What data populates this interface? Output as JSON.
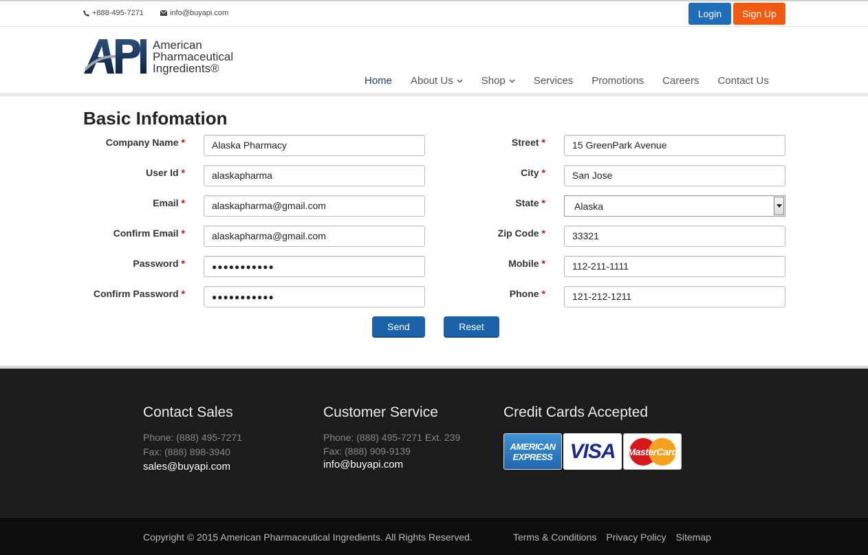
{
  "topbar": {
    "phone": "+888-495-7271",
    "email": "info@buyapi.com",
    "login_label": "Login",
    "signup_label": "Sign Up"
  },
  "logo": {
    "mark": "API",
    "line1": "American",
    "line2": "Pharmaceutical",
    "line3": "Ingredients®"
  },
  "nav": {
    "items": [
      "Home",
      "About Us",
      "Shop",
      "Services",
      "Promotions",
      "Careers",
      "Contact Us"
    ]
  },
  "form": {
    "title": "Basic Infomation",
    "required_mark": "*",
    "left": {
      "company_label": "Company Name",
      "company_value": "Alaska Pharmacy",
      "userid_label": "User Id",
      "userid_value": "alaskapharma",
      "email_label": "Email",
      "email_value": "alaskapharma@gmail.com",
      "confirm_email_label": "Confirm Email",
      "confirm_email_value": "alaskapharma@gmail.com",
      "password_label": "Password",
      "password_value": "●●●●●●●●●●●",
      "confirm_password_label": "Confirm Password",
      "confirm_password_value": "●●●●●●●●●●●"
    },
    "right": {
      "street_label": "Street",
      "street_value": "15 GreenPark Avenue",
      "city_label": "City",
      "city_value": "San Jose",
      "state_label": "State",
      "state_value": "Alaska",
      "zip_label": "Zip Code",
      "zip_value": "33321",
      "mobile_label": "Mobile",
      "mobile_value": "112-211-1111",
      "phone_label": "Phone",
      "phone_value": "121-212-1211"
    },
    "send_label": "Send",
    "reset_label": "Reset"
  },
  "footer": {
    "sales": {
      "heading": "Contact Sales",
      "phone": "Phone: (888) 495-7271",
      "fax": "Fax: (888) 898-3940",
      "email": "sales@buyapi.com"
    },
    "service": {
      "heading": "Customer Service",
      "phone": "Phone: (888) 495-7271 Ext. 239",
      "fax": "Fax: (888) 909-9139",
      "email": "info@buyapi.com"
    },
    "cards": {
      "heading": "Credit Cards Accepted",
      "amex_line1": "AMERICAN",
      "amex_line2": "EXPRESS",
      "visa": "VISA",
      "mastercard": "MasterCard"
    },
    "copyright": "Copyright © 2015 American Pharmaceutical Ingredients. All Rights Reserved.",
    "links": [
      "Terms & Conditions",
      "Privacy Policy",
      "Sitemap"
    ]
  },
  "colors": {
    "login": "#1f6fb8",
    "signup": "#f25a10",
    "primary_button": "#1a63a8",
    "required": "#cc1111",
    "footer_bg": "#1c1c1c"
  }
}
